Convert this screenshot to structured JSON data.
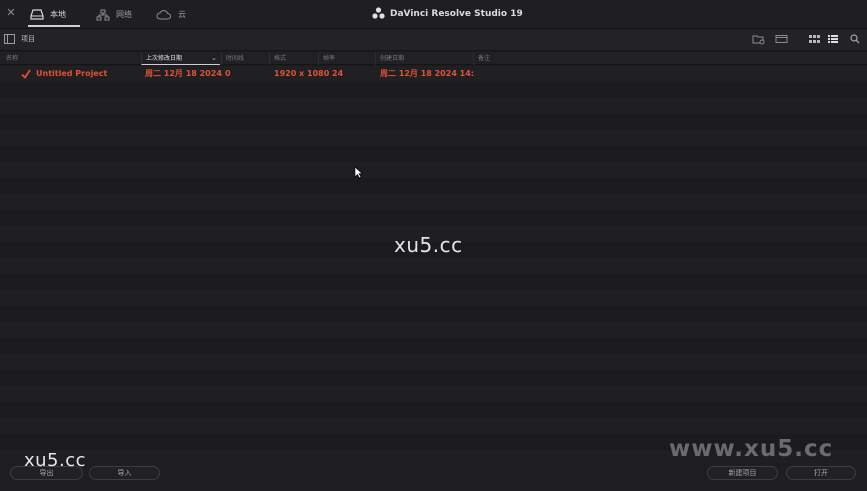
{
  "window": {
    "close_glyph": "✕",
    "title": "DaVinci Resolve Studio 19",
    "logo_icon": "davinci-logo-icon"
  },
  "tabs": [
    {
      "label": "本地",
      "icon": "drive-icon",
      "active": true
    },
    {
      "label": "网络",
      "icon": "network-icon",
      "active": false
    },
    {
      "label": "云",
      "icon": "cloud-icon",
      "active": false
    }
  ],
  "toolbar": {
    "label": "项目",
    "icons": [
      "new-folder-icon",
      "folder-icon",
      "grid-view-icon",
      "list-view-icon",
      "search-icon"
    ]
  },
  "columns": {
    "name": "名称",
    "modified": "上次修改日期",
    "timelines": "时间线",
    "format": "格式",
    "framerate": "帧率",
    "created": "创建日期",
    "notes": "备注"
  },
  "project": {
    "name": "Untitled Project",
    "modified": "周二 12月 18 2024...",
    "timelines": "0",
    "format": "1920 x 1080 24",
    "created": "周二 12月 18 2024 14:..."
  },
  "footer": {
    "export_label": "导出",
    "import_label": "导入",
    "new_project_label": "新建项目",
    "open_label": "打开"
  },
  "watermarks": {
    "center": "xu5.cc",
    "bottom_left": "xu5.cc",
    "bottom_right": "www.xu5.cc"
  },
  "colors": {
    "accent_red": "#e0503a",
    "background": "#1c1c1f"
  }
}
